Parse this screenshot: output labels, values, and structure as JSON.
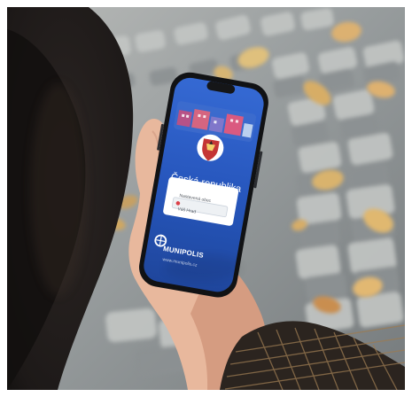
{
  "photo": {
    "scene": "",
    "colors": {
      "pavement": "#9ea3a2",
      "phone_screen": "#1e4db5",
      "phone_frame": "#17191c",
      "skin": "#e6b69c",
      "leaf": "#d8b06f"
    }
  },
  "app_screen": {
    "country": "Česká republika",
    "brand": "MUNIPOLIS",
    "website": "www.munipolis.cz",
    "select_label": "Nastavená obec",
    "search_value": "Váš Hrad",
    "icons": [
      "coat-of-arms-icon",
      "munipolis-logo-icon",
      "location-pin-icon"
    ]
  }
}
